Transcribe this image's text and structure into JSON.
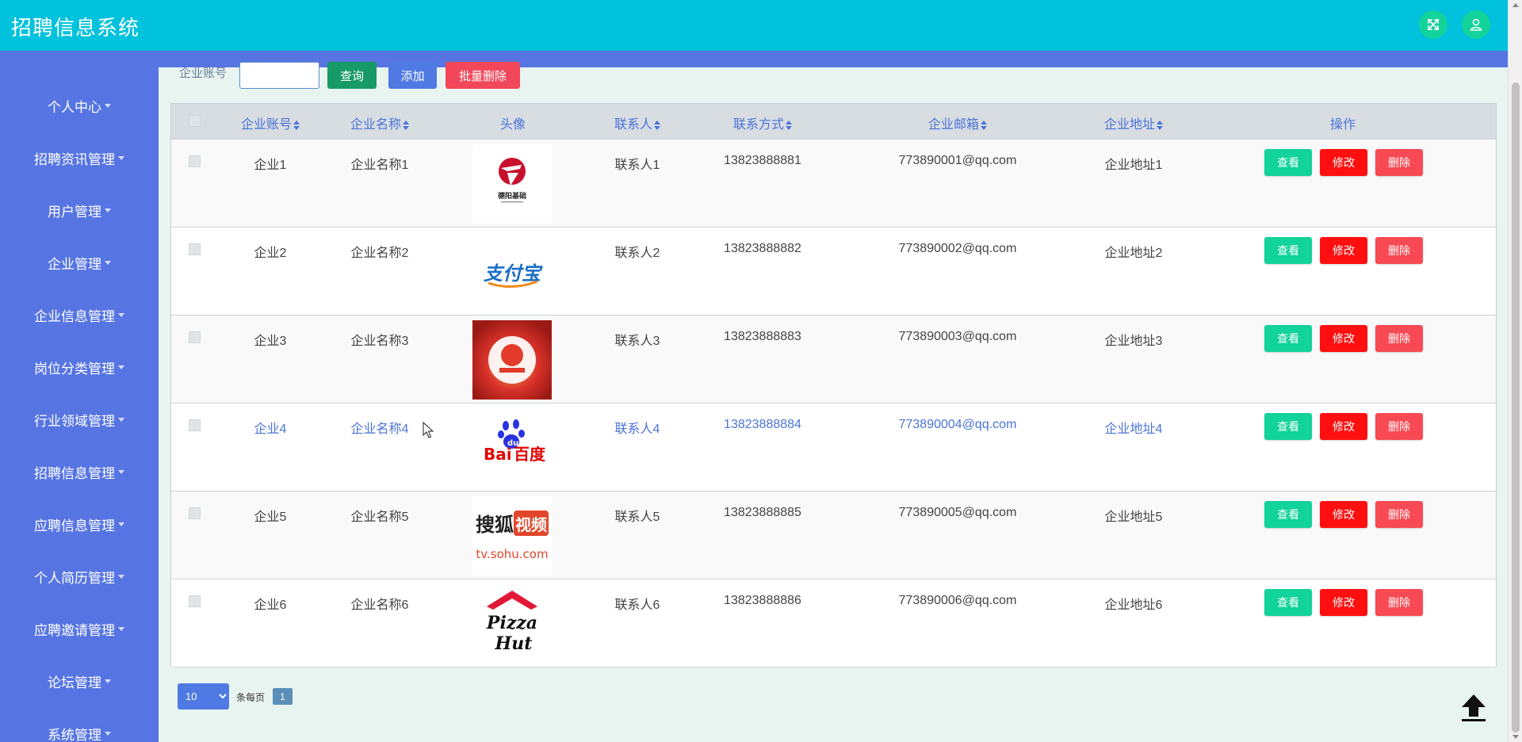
{
  "app": {
    "title": "招聘信息系统"
  },
  "header": {
    "fullscreen_icon": "expand-icon",
    "user_icon": "user-icon"
  },
  "sidebar": {
    "items": [
      {
        "label": "个人中心"
      },
      {
        "label": "招聘资讯管理"
      },
      {
        "label": "用户管理"
      },
      {
        "label": "企业管理"
      },
      {
        "label": "企业信息管理"
      },
      {
        "label": "岗位分类管理"
      },
      {
        "label": "行业领域管理"
      },
      {
        "label": "招聘信息管理"
      },
      {
        "label": "应聘信息管理"
      },
      {
        "label": "个人简历管理"
      },
      {
        "label": "应聘邀请管理"
      },
      {
        "label": "论坛管理"
      },
      {
        "label": "系统管理"
      }
    ]
  },
  "toolbar": {
    "search_label": "企业账号",
    "search_value": "",
    "query_label": "查询",
    "add_label": "添加",
    "batch_delete_label": "批量删除"
  },
  "table": {
    "columns": [
      "企业账号",
      "企业名称",
      "头像",
      "联系人",
      "联系方式",
      "企业邮箱",
      "企业地址",
      "操作"
    ],
    "actions": {
      "view": "查看",
      "edit": "修改",
      "delete": "删除"
    },
    "rows": [
      {
        "account": "企业1",
        "name": "企业名称1",
        "avatar": "logo-red-emblem",
        "contact": "联系人1",
        "phone": "13823888881",
        "email": "773890001@qq.com",
        "address": "企业地址1"
      },
      {
        "account": "企业2",
        "name": "企业名称2",
        "avatar": "logo-alipay",
        "contact": "联系人2",
        "phone": "13823888882",
        "email": "773890002@qq.com",
        "address": "企业地址2"
      },
      {
        "account": "企业3",
        "name": "企业名称3",
        "avatar": "logo-pizza-photo",
        "contact": "联系人3",
        "phone": "13823888883",
        "email": "773890003@qq.com",
        "address": "企业地址3"
      },
      {
        "account": "企业4",
        "name": "企业名称4",
        "avatar": "logo-baidu",
        "contact": "联系人4",
        "phone": "13823888884",
        "email": "773890004@qq.com",
        "address": "企业地址4"
      },
      {
        "account": "企业5",
        "name": "企业名称5",
        "avatar": "logo-sohu-video",
        "contact": "联系人5",
        "phone": "13823888885",
        "email": "773890005@qq.com",
        "address": "企业地址5"
      },
      {
        "account": "企业6",
        "name": "企业名称6",
        "avatar": "logo-pizza-hut",
        "contact": "联系人6",
        "phone": "13823888886",
        "email": "773890006@qq.com",
        "address": "企业地址6"
      }
    ]
  },
  "logo_text": {
    "emblem": "德阳基础",
    "alipay": "支付宝",
    "baidu_a": "Bai",
    "baidu_b": "du",
    "baidu_c": "百度",
    "sohu_a": "搜狐",
    "sohu_b": "视频",
    "sohu_c": "tv.sohu.com",
    "pizza_a": "Pizza",
    "pizza_b": "Hut"
  },
  "pagination": {
    "page_size": "10",
    "per_page_label": "条每页",
    "current_page": "1"
  },
  "colors": {
    "header": "#00c2dc",
    "sidebar": "#5775e2",
    "view": "#12d39a",
    "edit": "#ff1010",
    "delete": "#f74a55"
  }
}
